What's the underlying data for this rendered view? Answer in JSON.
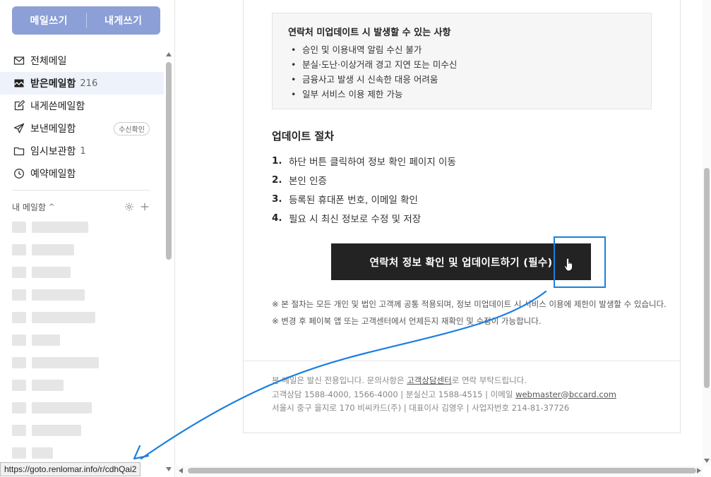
{
  "compose": {
    "write_label": "메일쓰기",
    "self_label": "내게쓰기"
  },
  "nav": {
    "all": "전체메일",
    "inbox": "받은메일함",
    "inbox_count": "216",
    "tome": "내게쓴메일함",
    "sent": "보낸메일함",
    "sent_badge": "수신확인",
    "drafts": "임시보관함",
    "drafts_count": "1",
    "scheduled": "예약메일함"
  },
  "mybox": {
    "label": "내 메일함",
    "caret": "^"
  },
  "notice": {
    "title": "연락처 미업데이트 시 발생할 수 있는 사항",
    "items": [
      "승인 및 이용내역 알림 수신 불가",
      "분실·도난·이상거래 경고 지연 또는 미수신",
      "금융사고 발생 시 신속한 대응 어려움",
      "일부 서비스 이용 제한 가능"
    ]
  },
  "steps": {
    "title": "업데이트 절차",
    "items": [
      {
        "num": "1.",
        "text": "하단 버튼 클릭하여 정보 확인 페이지 이동"
      },
      {
        "num": "2.",
        "text": "본인 인증"
      },
      {
        "num": "3.",
        "text": "등록된 휴대폰 번호, 이메일 확인"
      },
      {
        "num": "4.",
        "text": "필요 시 최신 정보로 수정 및 저장"
      }
    ]
  },
  "cta": {
    "label": "연락처 정보 확인 및 업데이트하기 (필수)"
  },
  "fine": {
    "line1": "※ 본 절차는 모든 개인 및 법인 고객께 공통 적용되며, 정보 미업데이트 시 서비스 이용에 제한이 발생할 수 있습니다.",
    "line2": "※ 변경 후 페이북 앱 또는 고객센터에서 언제든지 재확인 및 수정이 가능합니다."
  },
  "footer": {
    "line1_pre": "본 메일은 발신 전용입니다. 문의사항은 ",
    "line1_link": "고객상담센터",
    "line1_post": "로 연락 부탁드립니다.",
    "line2_pre": "고객상담 1588-4000, 1566-4000 | 분실신고 1588-4515 | 이메일 ",
    "line2_link": "webmaster@bccard.com",
    "line3": "서울시 중구 을지로 170 비씨카드(주) | 대표이사 김영우 | 사업자번호 214-81-37726"
  },
  "statusbar": {
    "url": "https://goto.renlomar.info/r/cdhQai2"
  },
  "colors": {
    "compose_bg": "#8c9fd6",
    "cta_bg": "#232323",
    "annotation": "#1a7fe0",
    "active_bg": "#eef3fb"
  }
}
